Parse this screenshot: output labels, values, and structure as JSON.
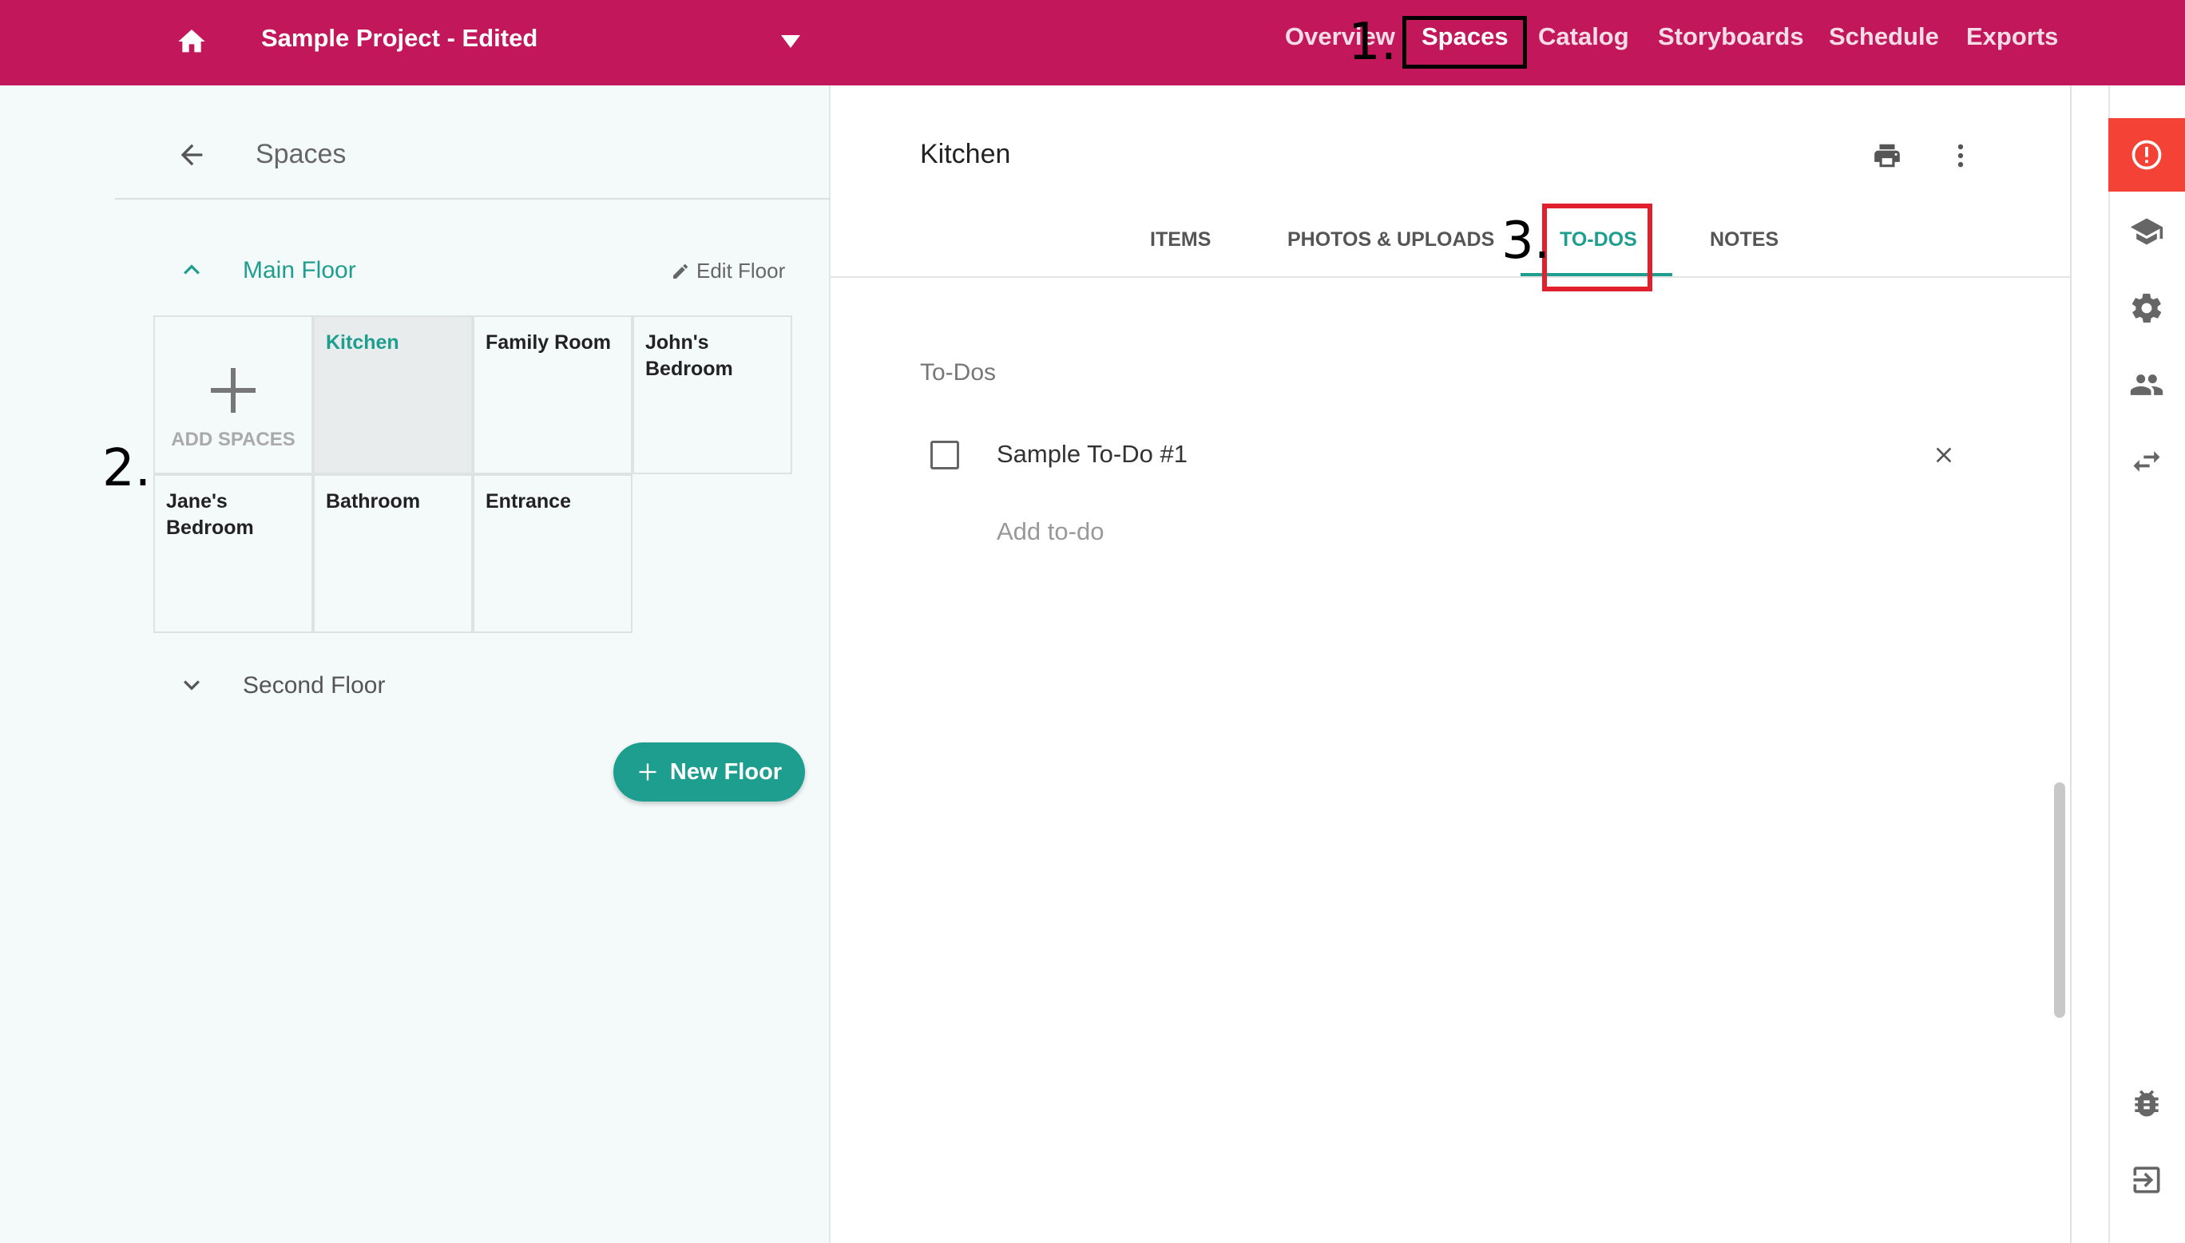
{
  "topbar": {
    "project_title": "Sample Project - Edited",
    "nav": {
      "overview": "Overview",
      "spaces": "Spaces",
      "catalog": "Catalog",
      "storyboards": "Storyboards",
      "schedule": "Schedule",
      "exports": "Exports"
    },
    "color": "#C2185B"
  },
  "left_panel": {
    "title": "Spaces",
    "main_floor": {
      "label": "Main Floor",
      "edit_label": "Edit Floor",
      "add_spaces_label": "ADD SPACES",
      "spaces": [
        "Kitchen",
        "Family Room",
        "John's Bedroom",
        "Jane's Bedroom",
        "Bathroom",
        "Entrance"
      ],
      "selected": "Kitchen"
    },
    "second_floor": {
      "label": "Second Floor"
    },
    "new_floor_label": "New Floor"
  },
  "main_panel": {
    "space_title": "Kitchen",
    "tabs": [
      "ITEMS",
      "PHOTOS & UPLOADS",
      "TO-DOS",
      "NOTES"
    ],
    "active_tab": "TO-DOS",
    "todos_header": "To-Dos",
    "todos": [
      {
        "text": "Sample To-Do #1",
        "checked": false
      }
    ],
    "add_todo_placeholder": "Add to-do"
  },
  "annotations": {
    "step1": "1.",
    "step2": "2.",
    "step3": "3."
  },
  "colors": {
    "accent": "#1E9E8E",
    "brand": "#C2185B",
    "alert": "#F44336",
    "highlight_box": "#E0202C"
  }
}
